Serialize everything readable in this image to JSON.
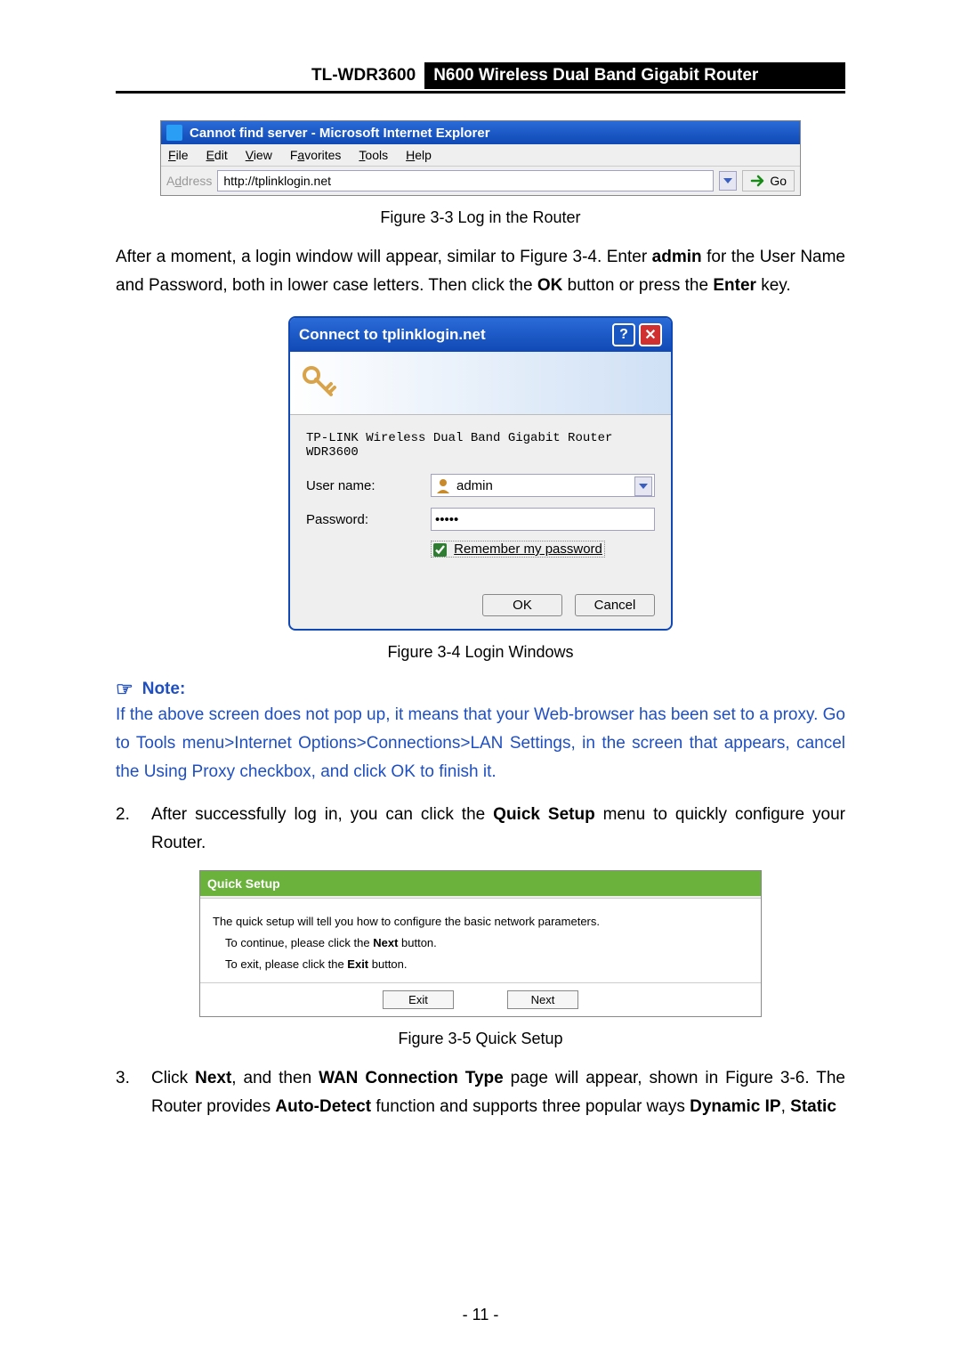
{
  "header": {
    "model": "TL-WDR3600",
    "product": "N600 Wireless Dual Band Gigabit Router"
  },
  "ie_window": {
    "title": "Cannot find server - Microsoft Internet Explorer",
    "menus": {
      "file": "File",
      "edit": "Edit",
      "view": "View",
      "fav": "Favorites",
      "tools": "Tools",
      "help": "Help"
    },
    "addr_label": "Address",
    "url": "http://tplinklogin.net",
    "go_label": "Go"
  },
  "fig_3_3": "Figure 3-3 Log in the Router",
  "para_login_text": "After a moment, a login window will appear, similar to Figure 3-4. Enter admin for the User Name and Password, both in lower case letters. Then click the OK button or press the Enter key.",
  "login_dialog": {
    "title": "Connect to tplinklogin.net",
    "router_name": "TP-LINK Wireless Dual Band Gigabit Router WDR3600",
    "username_label": "User name:",
    "username_value": "admin",
    "password_label": "Password:",
    "password_value": "•••••",
    "remember_label": "Remember my password",
    "ok": "OK",
    "cancel": "Cancel"
  },
  "fig_3_4": "Figure 3-4 Login Windows",
  "note_head": "Note:",
  "note_body": "If the above screen does not pop up, it means that your Web-browser has been set to a proxy. Go to Tools menu>Internet Options>Connections>LAN Settings, in the screen that appears, cancel the Using Proxy checkbox, and click OK to finish it.",
  "step2_text": "After successfully log in, you can click the Quick Setup menu to quickly configure your Router.",
  "quick_setup": {
    "title": "Quick Setup",
    "line1": "The quick setup will tell you how to configure the basic network parameters.",
    "cont_pre": "To continue, please click the ",
    "cont_bold": "Next",
    "cont_post": " button.",
    "exit_pre": "To exit, please click the ",
    "exit_bold": "Exit",
    "exit_post": " button.",
    "exit_btn": "Exit",
    "next_btn": "Next"
  },
  "fig_3_5": "Figure 3-5 Quick Setup",
  "step3_text": "Click Next, and then WAN Connection Type page will appear, shown in Figure 3-6. The Router provides Auto-Detect function and supports three popular ways Dynamic IP, Static",
  "page_number": "- 11 -"
}
